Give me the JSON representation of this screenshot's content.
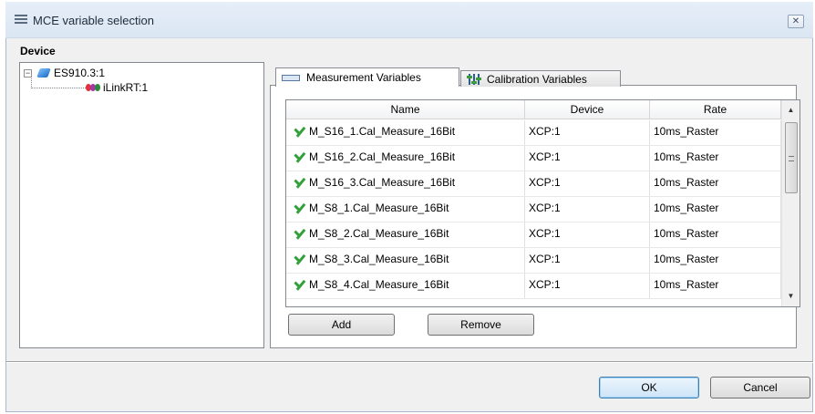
{
  "window": {
    "title": "MCE variable selection",
    "close_glyph": "✕"
  },
  "device": {
    "label": "Device",
    "tree": [
      {
        "label": "ES910.3:1",
        "expander": "−",
        "icon": "hardware-module-icon"
      },
      {
        "label": "iLinkRT:1",
        "icon": "ilink-connector-icon"
      }
    ]
  },
  "tabs": [
    {
      "label": "Measurement Variables",
      "active": true,
      "icon": "measurement-icon"
    },
    {
      "label": "Calibration Variables",
      "active": false,
      "icon": "calibration-sliders-icon"
    }
  ],
  "table": {
    "columns": [
      "Name",
      "Device",
      "Rate"
    ],
    "rows": [
      {
        "name": "M_S16_1.Cal_Measure_16Bit",
        "device": "XCP:1",
        "rate": "10ms_Raster"
      },
      {
        "name": "M_S16_2.Cal_Measure_16Bit",
        "device": "XCP:1",
        "rate": "10ms_Raster"
      },
      {
        "name": "M_S16_3.Cal_Measure_16Bit",
        "device": "XCP:1",
        "rate": "10ms_Raster"
      },
      {
        "name": "M_S8_1.Cal_Measure_16Bit",
        "device": "XCP:1",
        "rate": "10ms_Raster"
      },
      {
        "name": "M_S8_2.Cal_Measure_16Bit",
        "device": "XCP:1",
        "rate": "10ms_Raster"
      },
      {
        "name": "M_S8_3.Cal_Measure_16Bit",
        "device": "XCP:1",
        "rate": "10ms_Raster"
      },
      {
        "name": "M_S8_4.Cal_Measure_16Bit",
        "device": "XCP:1",
        "rate": "10ms_Raster"
      }
    ],
    "status_icon": "green-check-icon"
  },
  "scrollbar": {
    "up_glyph": "▲",
    "down_glyph": "▼"
  },
  "buttons": {
    "add": "Add",
    "remove": "Remove",
    "ok": "OK",
    "cancel": "Cancel"
  },
  "colors": {
    "check": "#33a13a",
    "title_bar": "#dbe6f3",
    "ok_border": "#3c7fb1"
  }
}
